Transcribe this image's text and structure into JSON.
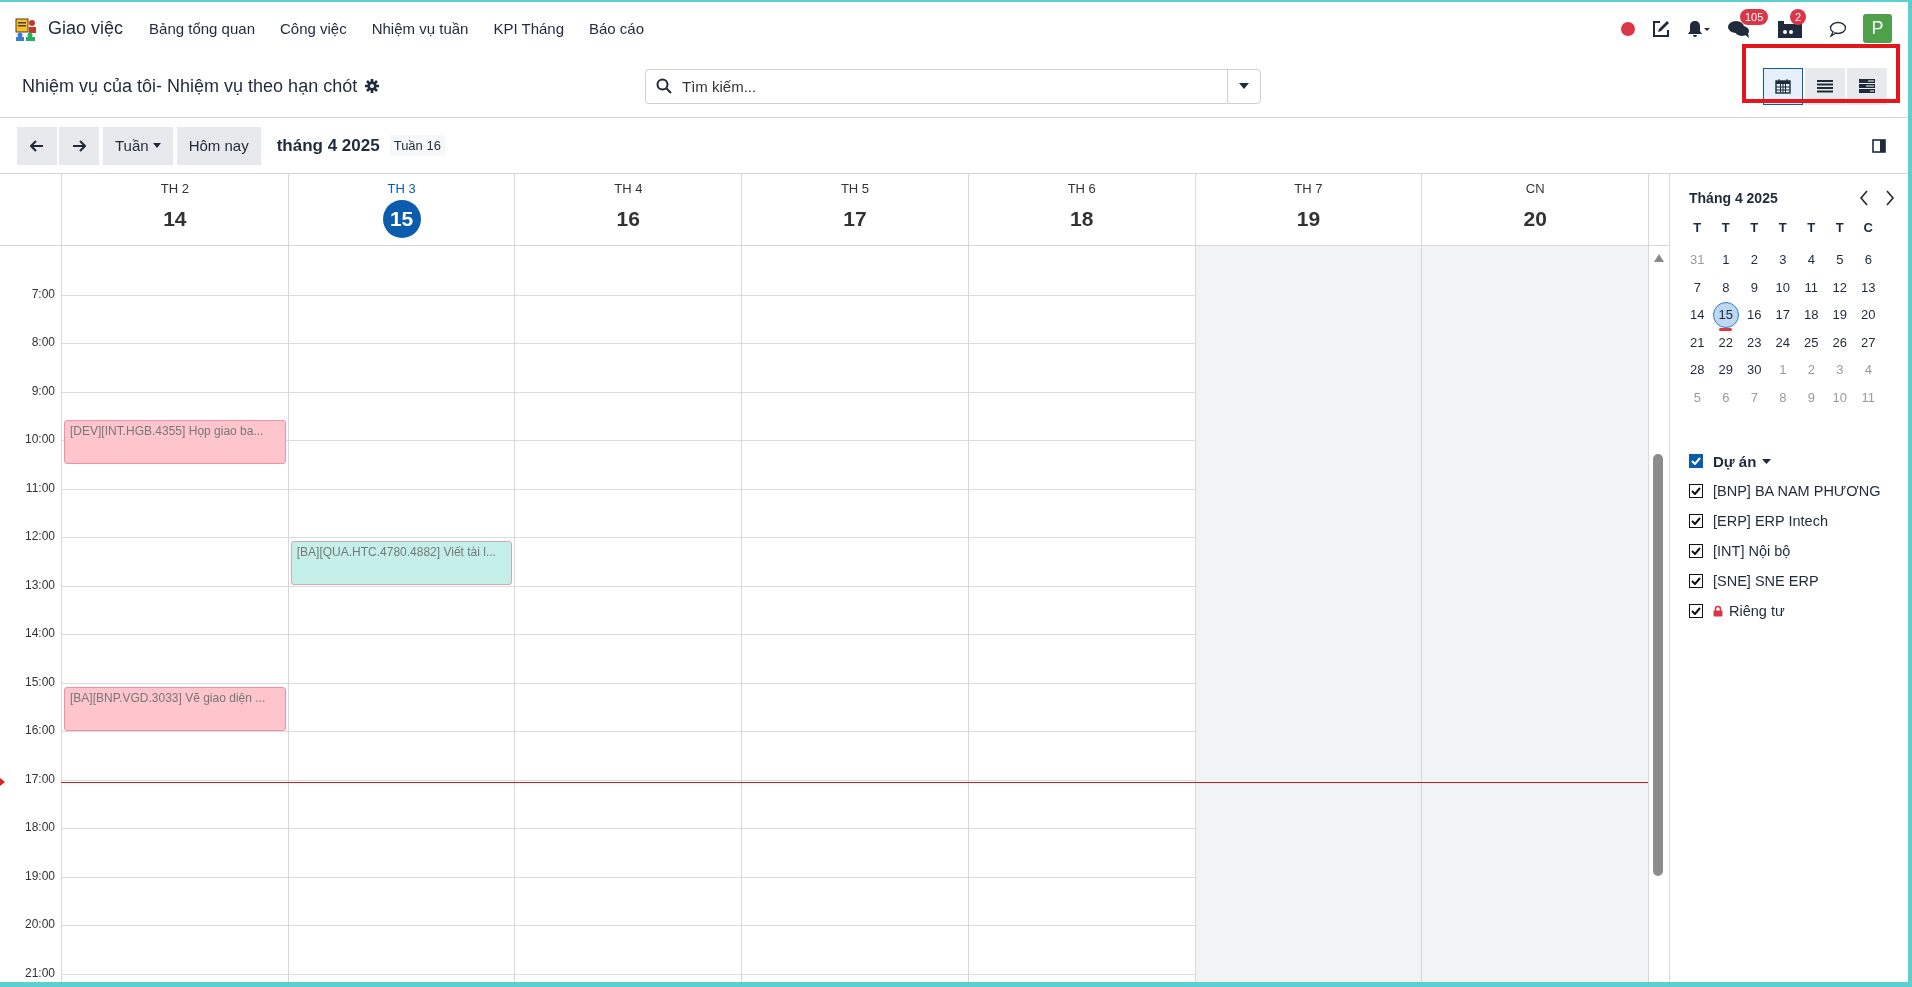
{
  "app": {
    "name": "Giao việc"
  },
  "menu": [
    "Bảng tổng quan",
    "Công việc",
    "Nhiệm vụ tuần",
    "KPI Tháng",
    "Báo cáo"
  ],
  "systray": {
    "chat_count": "105",
    "video_count": "2",
    "avatar": "P"
  },
  "breadcrumb": "Nhiệm vụ của tôi- Nhiệm vụ theo hạn chót",
  "search": {
    "placeholder": "Tìm kiếm..."
  },
  "views": [
    {
      "kind": "calendar",
      "selected": true
    },
    {
      "kind": "list",
      "selected": false
    },
    {
      "kind": "gantt",
      "selected": false
    }
  ],
  "toolbar": {
    "scale": "Tuần",
    "today": "Hôm nay",
    "period": "tháng 4 2025",
    "week": "Tuần 16"
  },
  "days": [
    {
      "label": "TH 2",
      "number": "14",
      "today": false,
      "weekend": false,
      "events": [
        {
          "title": "[DEV][INT.HGB.4355] Họp giao ba...",
          "color": "#ffc5cc"
        },
        {
          "title": "[BA][BNP.VGD.3033] Vẽ giao diện ...",
          "color": "#ffc5cc"
        }
      ]
    },
    {
      "label": "TH 3",
      "number": "15",
      "today": true,
      "weekend": false,
      "events": [
        {
          "title": "[BA][QUA.HTC.4780.4882] Viết tài l...",
          "color": "#c5f0ea"
        }
      ]
    },
    {
      "label": "TH 4",
      "number": "16",
      "today": false,
      "weekend": false
    },
    {
      "label": "TH 5",
      "number": "17",
      "today": false,
      "weekend": false
    },
    {
      "label": "TH 6",
      "number": "18",
      "today": false,
      "weekend": false
    },
    {
      "label": "TH 7",
      "number": "19",
      "today": false,
      "weekend": true
    },
    {
      "label": "CN",
      "number": "20",
      "today": false,
      "weekend": true
    }
  ],
  "hours": [
    "7:00",
    "8:00",
    "9:00",
    "10:00",
    "11:00",
    "12:00",
    "13:00",
    "14:00",
    "15:00",
    "16:00",
    "17:00",
    "18:00",
    "19:00",
    "20:00",
    "21:00"
  ],
  "mini_calendar": {
    "title": "Tháng 4 2025",
    "weekdays": [
      "T",
      "T",
      "T",
      "T",
      "T",
      "T",
      "C"
    ],
    "weeks": [
      [
        {
          "day": "31",
          "muted": true,
          "selected": false
        },
        {
          "day": "1",
          "muted": false,
          "selected": false
        },
        {
          "day": "2",
          "muted": false,
          "selected": false
        },
        {
          "day": "3",
          "muted": false,
          "selected": false
        },
        {
          "day": "4",
          "muted": false,
          "selected": false
        },
        {
          "day": "5",
          "muted": false,
          "selected": false
        },
        {
          "day": "6",
          "muted": false,
          "selected": false
        }
      ],
      [
        {
          "day": "7",
          "muted": false,
          "selected": false
        },
        {
          "day": "8",
          "muted": false,
          "selected": false
        },
        {
          "day": "9",
          "muted": false,
          "selected": false
        },
        {
          "day": "10",
          "muted": false,
          "selected": false
        },
        {
          "day": "11",
          "muted": false,
          "selected": false
        },
        {
          "day": "12",
          "muted": false,
          "selected": false
        },
        {
          "day": "13",
          "muted": false,
          "selected": false
        }
      ],
      [
        {
          "day": "14",
          "muted": false,
          "selected": false
        },
        {
          "day": "15",
          "muted": false,
          "selected": true
        },
        {
          "day": "16",
          "muted": false,
          "selected": false
        },
        {
          "day": "17",
          "muted": false,
          "selected": false
        },
        {
          "day": "18",
          "muted": false,
          "selected": false
        },
        {
          "day": "19",
          "muted": false,
          "selected": false
        },
        {
          "day": "20",
          "muted": false,
          "selected": false
        }
      ],
      [
        {
          "day": "21",
          "muted": false,
          "selected": false
        },
        {
          "day": "22",
          "muted": false,
          "selected": false
        },
        {
          "day": "23",
          "muted": false,
          "selected": false
        },
        {
          "day": "24",
          "muted": false,
          "selected": false
        },
        {
          "day": "25",
          "muted": false,
          "selected": false
        },
        {
          "day": "26",
          "muted": false,
          "selected": false
        },
        {
          "day": "27",
          "muted": false,
          "selected": false
        }
      ],
      [
        {
          "day": "28",
          "muted": false,
          "selected": false
        },
        {
          "day": "29",
          "muted": false,
          "selected": false
        },
        {
          "day": "30",
          "muted": false,
          "selected": false
        },
        {
          "day": "1",
          "muted": true,
          "selected": false
        },
        {
          "day": "2",
          "muted": true,
          "selected": false
        },
        {
          "day": "3",
          "muted": true,
          "selected": false
        },
        {
          "day": "4",
          "muted": true,
          "selected": false
        }
      ],
      [
        {
          "day": "5",
          "muted": true,
          "selected": false
        },
        {
          "day": "6",
          "muted": true,
          "selected": false
        },
        {
          "day": "7",
          "muted": true,
          "selected": false
        },
        {
          "day": "8",
          "muted": true,
          "selected": false
        },
        {
          "day": "9",
          "muted": true,
          "selected": false
        },
        {
          "day": "10",
          "muted": true,
          "selected": false
        },
        {
          "day": "11",
          "muted": true,
          "selected": false
        }
      ]
    ]
  },
  "filters": {
    "group": {
      "label": "Dự án",
      "checked": true
    },
    "items": [
      {
        "label": "[BNP] BA NAM PHƯƠNG",
        "checked": true,
        "kind": "project"
      },
      {
        "label": "[ERP] ERP Intech",
        "checked": true,
        "kind": "project"
      },
      {
        "label": "[INT] Nội bộ",
        "checked": true,
        "kind": "project"
      },
      {
        "label": "[SNE] SNE ERP",
        "checked": true,
        "kind": "project"
      },
      {
        "label": "Riêng tư",
        "checked": true,
        "kind": "private"
      }
    ]
  }
}
